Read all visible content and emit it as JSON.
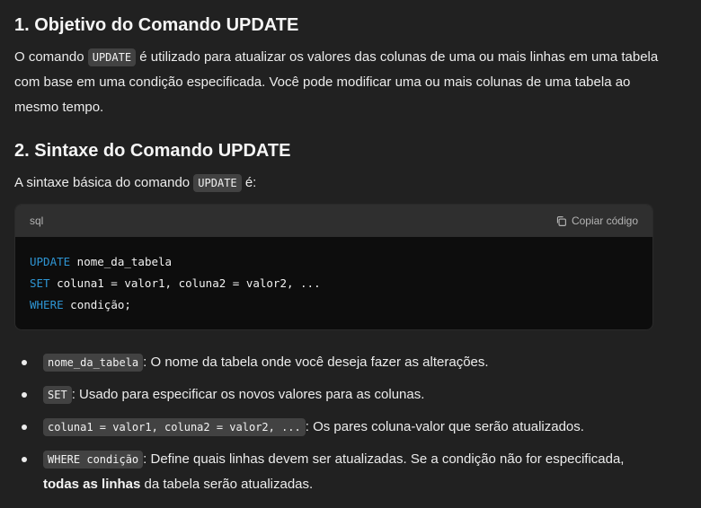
{
  "section1": {
    "title": "1. Objetivo do Comando UPDATE",
    "p_pre": "O comando ",
    "code": "UPDATE",
    "p_post": " é utilizado para atualizar os valores das colunas de uma ou mais linhas em uma tabela com base em uma condição especificada. Você pode modificar uma ou mais colunas de uma tabela ao mesmo tempo."
  },
  "section2": {
    "title": "2. Sintaxe do Comando UPDATE",
    "p_pre": "A sintaxe básica do comando ",
    "code": "UPDATE",
    "p_post": " é:"
  },
  "codeblock": {
    "language": "sql",
    "copy_label": "Copiar código",
    "lines": [
      {
        "kw": "UPDATE",
        "rest": " nome_da_tabela"
      },
      {
        "kw": "SET",
        "rest": " coluna1 = valor1, coluna2 = valor2, ..."
      },
      {
        "kw": "WHERE",
        "rest": " condição;"
      }
    ]
  },
  "bullets": [
    {
      "code": "nome_da_tabela",
      "text": ": O nome da tabela onde você deseja fazer as alterações."
    },
    {
      "code": "SET",
      "text": ": Usado para especificar os novos valores para as colunas."
    },
    {
      "code": "coluna1 = valor1, coluna2 = valor2, ...",
      "text": ": Os pares coluna-valor que serão atualizados."
    },
    {
      "code": "WHERE condição",
      "text": ": Define quais linhas devem ser atualizadas. Se a condição não for especificada, ",
      "bold": "todas as linhas",
      "text2": " da tabela serão atualizadas."
    }
  ]
}
